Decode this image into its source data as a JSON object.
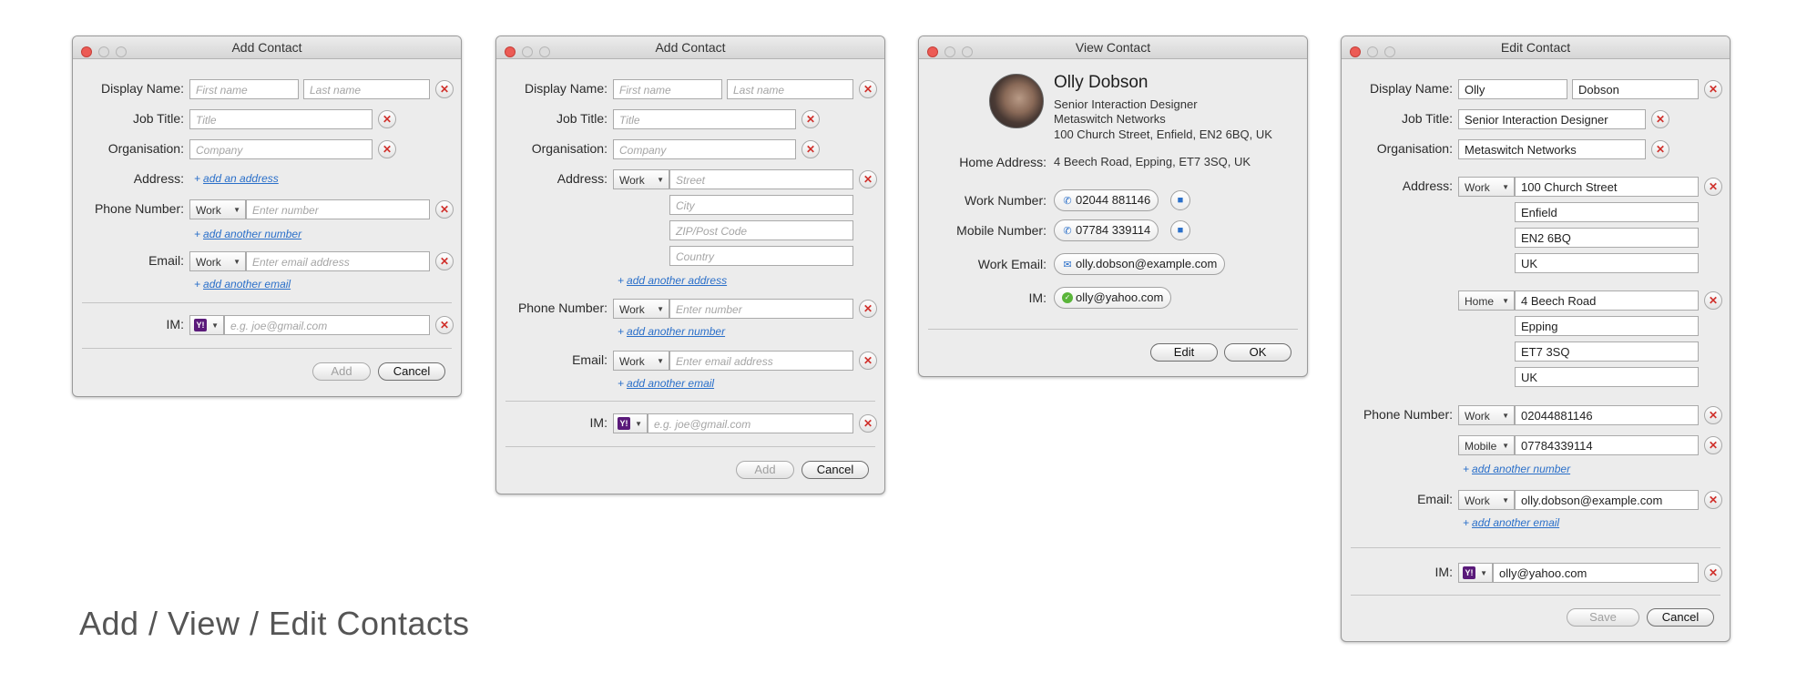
{
  "caption": "Add / View / Edit Contacts",
  "labels": {
    "display_name": "Display Name:",
    "job_title": "Job Title:",
    "organisation": "Organisation:",
    "address": "Address:",
    "phone_number": "Phone Number:",
    "email": "Email:",
    "im": "IM:",
    "home_address": "Home Address:",
    "work_number": "Work Number:",
    "mobile_number": "Mobile Number:",
    "work_email": "Work Email:"
  },
  "placeholders": {
    "first_name": "First name",
    "last_name": "Last name",
    "title": "Title",
    "company": "Company",
    "enter_number": "Enter number",
    "enter_email": "Enter email address",
    "im": "e.g. joe@gmail.com",
    "street": "Street",
    "city": "City",
    "zip": "ZIP/Post Code",
    "country": "Country"
  },
  "links": {
    "add_address": "add an address",
    "add_another_address": "add another address",
    "add_another_number": "add another number",
    "add_another_email": "add another email"
  },
  "selects": {
    "work": "Work",
    "home": "Home",
    "mobile": "Mobile"
  },
  "im_service_badge": "Y!",
  "buttons": {
    "add": "Add",
    "cancel": "Cancel",
    "edit": "Edit",
    "ok": "OK",
    "save": "Save"
  },
  "windows": {
    "add1": {
      "title": "Add Contact"
    },
    "add2": {
      "title": "Add Contact"
    },
    "view": {
      "title": "View Contact",
      "name": "Olly Dobson",
      "job": "Senior Interaction Designer",
      "org": "Metaswitch Networks",
      "address_line": "100 Church Street, Enfield, EN2 6BQ, UK",
      "home_address": "4 Beech Road, Epping, ET7 3SQ, UK",
      "work_number": "02044 881146",
      "mobile_number": "07784 339114",
      "work_email": "olly.dobson@example.com",
      "im": "olly@yahoo.com"
    },
    "edit": {
      "title": "Edit Contact",
      "first": "Olly",
      "last": "Dobson",
      "job": "Senior Interaction Designer",
      "org": "Metaswitch Networks",
      "work_address": [
        "100 Church Street",
        "Enfield",
        "EN2 6BQ",
        "UK"
      ],
      "home_address": [
        "4 Beech Road",
        "Epping",
        "ET7 3SQ",
        "UK"
      ],
      "phone_work": "02044881146",
      "phone_mobile": "07784339114",
      "email": "olly.dobson@example.com",
      "im": "olly@yahoo.com"
    }
  },
  "colors": {
    "link": "#2a6fc9",
    "close_red": "#ec5b55",
    "remove_x": "#d0302b",
    "yahoo_purple": "#5a1a7a"
  },
  "icons": {
    "close": "x-icon",
    "phone": "phone-icon",
    "video": "video-call-icon",
    "mail": "mail-icon",
    "im_status": "online-status-icon",
    "dropdown": "chevron-down-icon"
  }
}
